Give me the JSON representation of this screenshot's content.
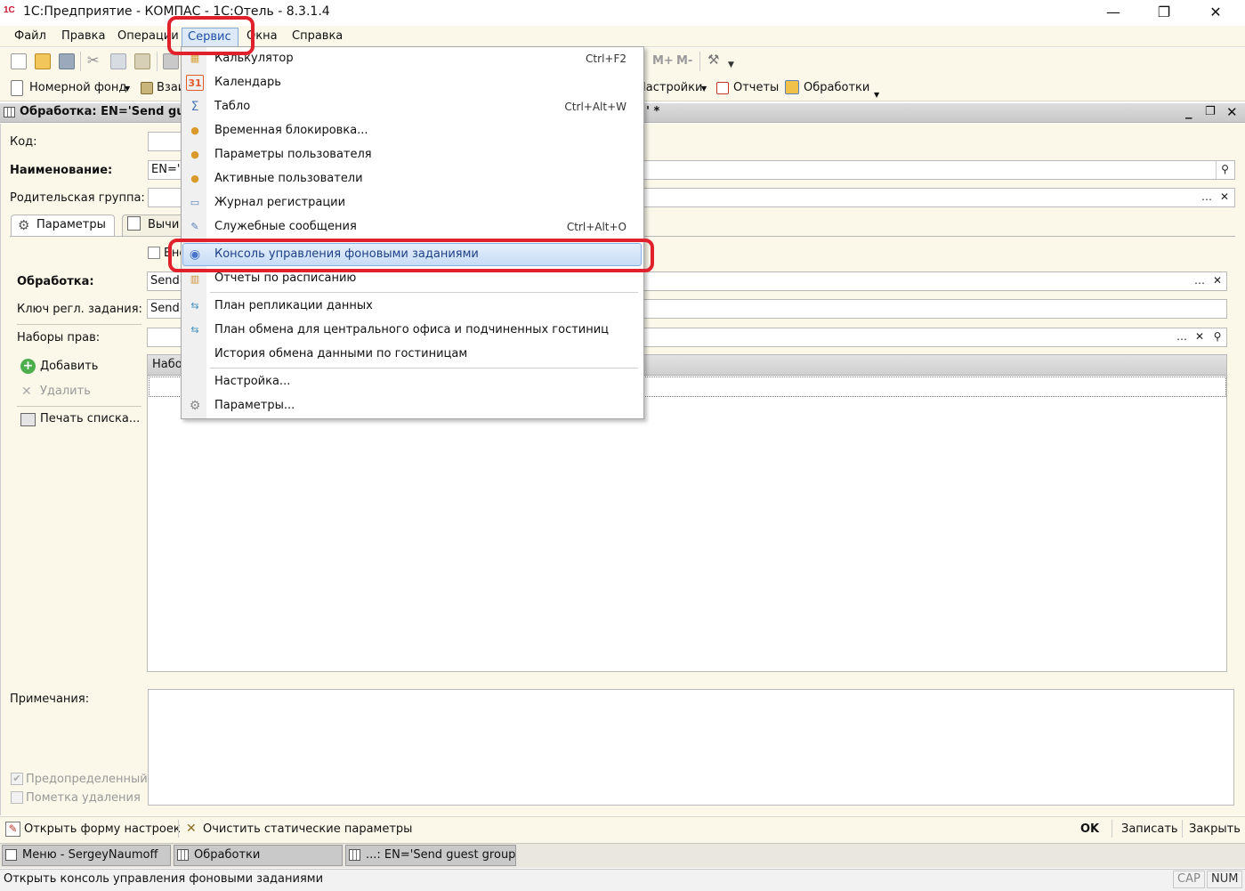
{
  "window": {
    "title": "1С:Предприятие - КОМПАС - 1С:Отель - 8.3.1.4",
    "logo": "1С",
    "controls": {
      "minimize": "—",
      "maximize": "❐",
      "close": "✕"
    }
  },
  "menubar": {
    "items": [
      "Файл",
      "Правка",
      "Операции",
      "Сервис",
      "Окна",
      "Справка"
    ],
    "active": "Сервис"
  },
  "toolbar": {
    "memory_buttons": [
      "M+",
      "M-"
    ],
    "toolbar2": {
      "room_fund": "Номерной фонд",
      "interactions": "Взаи",
      "settings": "Настройки",
      "reports": "Отчеты",
      "processings": "Обработки"
    }
  },
  "form": {
    "title": "Обработка: EN='Send gu",
    "title_tail": "' *",
    "labels": {
      "code": "Код:",
      "name": "Наименование:",
      "parent_group": "Родительская группа:",
      "processing": "Обработка:",
      "schedule_key": "Ключ регл. задания:",
      "rights_sets": "Наборы прав:",
      "notes": "Примечания:"
    },
    "values": {
      "name": "EN='S",
      "processing": "Send(",
      "schedule_key": "Send("
    },
    "tabs": [
      "Параметры",
      "Вычи"
    ],
    "checkbox_label": "Вне",
    "table_header": "Набо",
    "side_buttons": {
      "add": "Добавить",
      "delete": "Удалить",
      "print": "Печать списка..."
    },
    "flags": {
      "predefined": "Предопределенный",
      "deletion_mark": "Пометка удаления"
    }
  },
  "dropdown": {
    "items": [
      {
        "label": "Калькулятор",
        "shortcut": "Ctrl+F2",
        "icon": "calculator-icon",
        "glyph": "▦",
        "color": "#d8a23a"
      },
      {
        "label": "Календарь",
        "shortcut": "",
        "icon": "calendar-icon",
        "glyph": "31",
        "color": "#e05a2a"
      },
      {
        "label": "Табло",
        "shortcut": "Ctrl+Alt+W",
        "icon": "board-icon",
        "glyph": "Σ",
        "color": "#4a79b8"
      },
      {
        "label": "Временная блокировка...",
        "shortcut": "",
        "icon": "user-lock-icon",
        "glyph": "●",
        "color": "#d99a2b"
      },
      {
        "label": "Параметры пользователя",
        "shortcut": "",
        "icon": "user-settings-icon",
        "glyph": "●",
        "color": "#d99a2b"
      },
      {
        "label": "Активные пользователи",
        "shortcut": "",
        "icon": "active-users-icon",
        "glyph": "●",
        "color": "#d99a2b"
      },
      {
        "label": "Журнал регистрации",
        "shortcut": "",
        "icon": "log-icon",
        "glyph": "▭",
        "color": "#5b7fb6"
      },
      {
        "label": "Служебные сообщения",
        "shortcut": "Ctrl+Alt+O",
        "icon": "messages-icon",
        "glyph": "✎",
        "color": "#5b7fb6"
      },
      {
        "label": "Консоль управления фоновыми заданиями",
        "shortcut": "",
        "icon": "console-icon",
        "glyph": "◉",
        "color": "#4a74c9",
        "highlighted": true
      },
      {
        "label": "Отчеты по расписанию",
        "shortcut": "",
        "icon": "scheduled-reports-icon",
        "glyph": "▥",
        "color": "#d0903a"
      },
      {
        "label": "План репликации данных",
        "shortcut": "",
        "icon": "replication-icon",
        "glyph": "⇆",
        "color": "#3f8fbf"
      },
      {
        "label": "План обмена для центрального офиса и подчиненных гостиниц",
        "shortcut": "",
        "icon": "exchange-plan-icon",
        "glyph": "⇆",
        "color": "#3f8fbf"
      },
      {
        "label": "История обмена данными по гостиницам",
        "shortcut": "",
        "icon": "",
        "glyph": "",
        "color": ""
      },
      {
        "label": "Настройка...",
        "shortcut": "",
        "icon": "",
        "glyph": "",
        "color": ""
      },
      {
        "label": "Параметры...",
        "shortcut": "",
        "icon": "wrench-icon",
        "glyph": "⚙",
        "color": "#888888"
      }
    ]
  },
  "bottom": {
    "open_settings": "Открыть форму настроек",
    "clear_static": "Очистить статические параметры",
    "ok": "OK",
    "save": "Записать",
    "close": "Закрыть"
  },
  "taskbar": [
    "Меню - SergeyNaumoff",
    "Обработки",
    "...: EN='Send guest group ..."
  ],
  "status": {
    "message": "Открыть консоль управления фоновыми заданиями",
    "cap": "CAP",
    "num": "NUM"
  },
  "colors": {
    "accent": "#1e4fa8",
    "annotation": "#e0202a",
    "form_background": "#fbf8ea"
  }
}
